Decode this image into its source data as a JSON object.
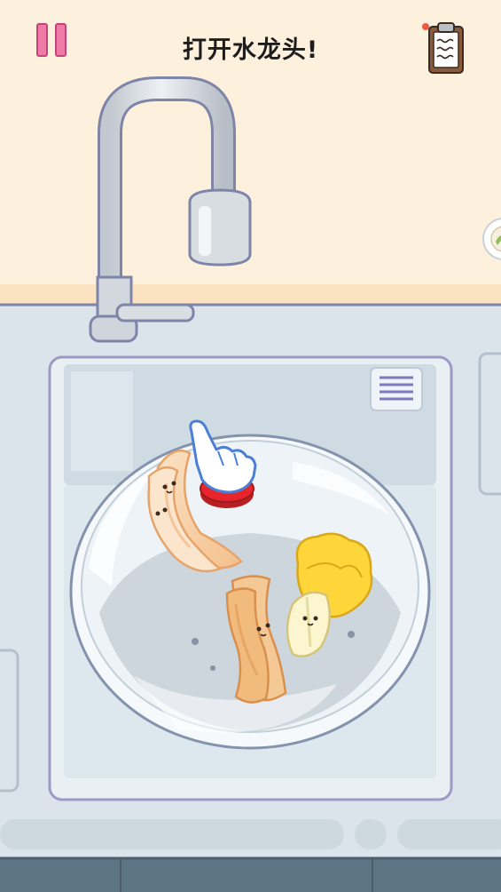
{
  "hud": {
    "instruction": "打开水龙头!",
    "pause_icon": "pause-icon",
    "recipe_icon": "clipboard-icon",
    "notification_dot_color": "#f05a3c"
  },
  "colors": {
    "wall": "#fdf1dd",
    "counter": "#dbe4ea",
    "basin": "#e9f0f4",
    "outline": "#7f85a8",
    "accent_pink": "#f07aa6",
    "faucet": "#d3d8de",
    "button_red": "#e8252b"
  },
  "items": [
    "bacon",
    "bacon",
    "napa-cabbage"
  ]
}
